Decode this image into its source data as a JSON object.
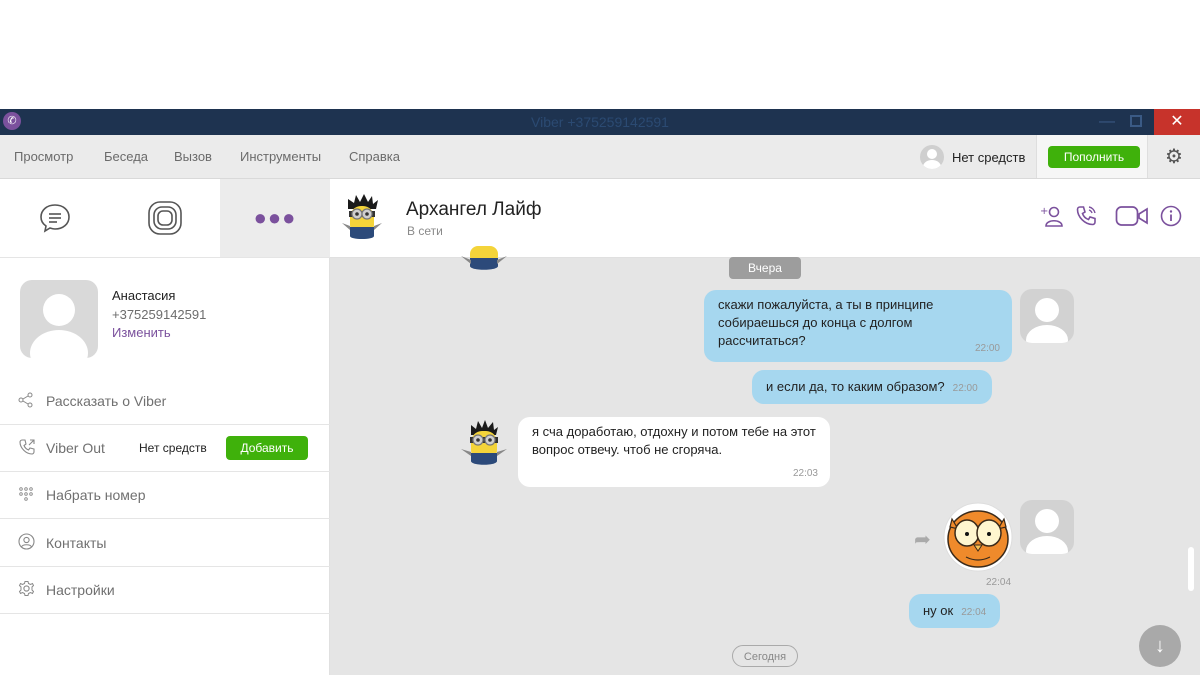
{
  "window": {
    "title": "Viber +375259142591",
    "min_glyph": "—",
    "close_glyph": "✕"
  },
  "menu": {
    "items": [
      "Просмотр",
      "Беседа",
      "Вызов",
      "Инструменты",
      "Справка"
    ],
    "balance_label": "Нет средств",
    "topup_label": "Пополнить"
  },
  "sidebar": {
    "tabs": [
      "chat-icon",
      "public-accounts-icon",
      "more-icon"
    ],
    "more_dots": "●●●",
    "profile": {
      "name": "Анастасия",
      "phone": "+375259142591",
      "edit_label": "Изменить"
    },
    "rows": {
      "share": "Рассказать о Viber",
      "viber_out": "Viber Out",
      "viber_out_balance": "Нет средств",
      "viber_out_add": "Добавить",
      "dial": "Набрать номер",
      "contacts": "Контакты",
      "settings": "Настройки"
    }
  },
  "chat": {
    "contact_name": "Архангел Лайф",
    "contact_status": "В сети",
    "date_yesterday": "Вчера",
    "date_today": "Сегодня",
    "messages": [
      {
        "dir": "out",
        "text": "скажи пожалуйста, а ты в принципе собираешься до конца с долгом рассчитаться?",
        "time": "22:00"
      },
      {
        "dir": "out",
        "text": "и если да, то каким образом?",
        "time": "22:00"
      },
      {
        "dir": "in",
        "text": "я сча доработаю, отдохну и потом тебе на этот вопрос отвечу. чтоб не сгоряча.",
        "time": "22:03"
      },
      {
        "dir": "out",
        "type": "sticker",
        "time": "22:04"
      },
      {
        "dir": "out",
        "text": "ну ок",
        "time": "22:04"
      }
    ]
  },
  "colors": {
    "viber_purple": "#7b519d",
    "green_button": "#3fb10b",
    "out_bubble": "#a6d7ef",
    "titlebar": "#1e3350"
  }
}
